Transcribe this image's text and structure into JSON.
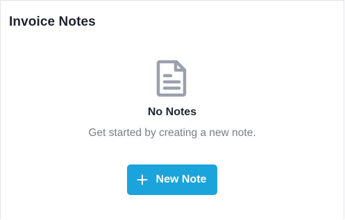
{
  "panel": {
    "title": "Invoice Notes"
  },
  "empty_state": {
    "icon": "document-icon",
    "title": "No Notes",
    "subtitle": "Get started by creating a new note."
  },
  "actions": {
    "new_note_label": "New Note",
    "new_note_icon": "plus-icon"
  },
  "colors": {
    "accent": "#1ba3dc",
    "icon_gray": "#9aa0ad",
    "text_primary": "#1f2330",
    "text_secondary": "#7a7e88"
  }
}
